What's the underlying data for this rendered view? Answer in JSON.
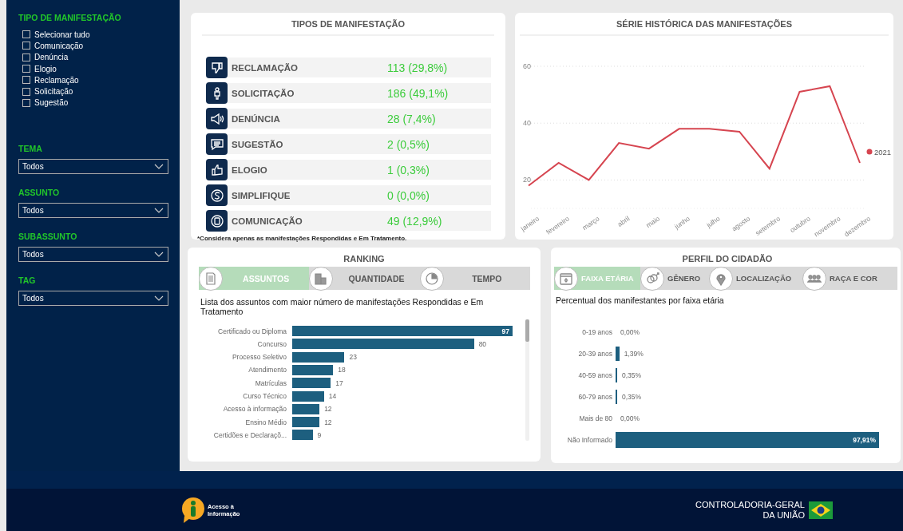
{
  "sidebar": {
    "filter_title": "TIPO DE MANIFESTAÇÃO",
    "options": [
      {
        "label": "Selecionar tudo",
        "checked": false
      },
      {
        "label": "Comunicação",
        "checked": false
      },
      {
        "label": "Denúncia",
        "checked": false
      },
      {
        "label": "Elogio",
        "checked": false
      },
      {
        "label": "Reclamação",
        "checked": false
      },
      {
        "label": "Solicitação",
        "checked": false
      },
      {
        "label": "Sugestão",
        "checked": false
      }
    ],
    "dropdowns": [
      {
        "label": "TEMA",
        "value": "Todos"
      },
      {
        "label": "ASSUNTO",
        "value": "Todos"
      },
      {
        "label": "SUBASSUNTO",
        "value": "Todos"
      },
      {
        "label": "TAG",
        "value": "Todos"
      }
    ]
  },
  "tipos": {
    "title": "TIPOS DE MANIFESTAÇÃO",
    "rows": [
      {
        "label": "RECLAMAÇÃO",
        "value": "113 (29,8%)"
      },
      {
        "label": "SOLICITAÇÃO",
        "value": "186 (49,1%)"
      },
      {
        "label": "DENÚNCIA",
        "value": "28 (7,4%)"
      },
      {
        "label": "SUGESTÃO",
        "value": "2 (0,5%)"
      },
      {
        "label": "ELOGIO",
        "value": "1 (0,3%)"
      },
      {
        "label": "SIMPLIFIQUE",
        "value": "0 (0,0%)"
      },
      {
        "label": "COMUNICAÇÃO",
        "value": "49 (12,9%)"
      }
    ],
    "footnote": "*Considera apenas as manifestações Respondidas e Em Tratamento."
  },
  "serie": {
    "title": "SÉRIE HISTÓRICA DAS MANIFESTAÇÕES",
    "chart_data": {
      "type": "line",
      "categories": [
        "janeiro",
        "fevereiro",
        "março",
        "abril",
        "maio",
        "junho",
        "julho",
        "agosto",
        "setembro",
        "outubro",
        "novembro",
        "dezembro"
      ],
      "series": [
        {
          "name": "2021",
          "color": "#d64550",
          "values": [
            18,
            26,
            20,
            33,
            31,
            38,
            38,
            37,
            24,
            51,
            53,
            26
          ]
        }
      ],
      "ylim": [
        10,
        60
      ],
      "yticks": [
        20,
        40,
        60
      ]
    }
  },
  "ranking": {
    "title": "RANKING",
    "tabs": [
      {
        "label": "ASSUNTOS",
        "selected": true
      },
      {
        "label": "QUANTIDADE",
        "selected": false
      },
      {
        "label": "TEMPO",
        "selected": false
      }
    ],
    "description": "Lista dos assuntos com maior número de manifestações Respondidas e Em Tratamento",
    "chart_data": {
      "type": "bar",
      "orientation": "horizontal",
      "data_labels": true,
      "categories": [
        "Certificado ou Diploma",
        "Concurso",
        "Processo Seletivo",
        "Atendimento",
        "Matrículas",
        "Curso Técnico",
        "Acesso à informação",
        "Ensino Médio",
        "Certidões e Declaraçõ..."
      ],
      "values": [
        97,
        80,
        23,
        18,
        17,
        14,
        12,
        12,
        9
      ]
    }
  },
  "perfil": {
    "title": "PERFIL DO CIDADÃO",
    "tabs": [
      {
        "label": "FAIXA ETÁRIA",
        "selected": true
      },
      {
        "label": "GÊNERO",
        "selected": false
      },
      {
        "label": "LOCALIZAÇÃO",
        "selected": false
      },
      {
        "label": "RAÇA E COR",
        "selected": false
      }
    ],
    "description": "Percentual dos manifestantes por faixa etária",
    "chart_data": {
      "type": "bar",
      "orientation": "horizontal",
      "categories": [
        "0-19 anos",
        "20-39 anos",
        "40-59 anos",
        "60-79 anos",
        "Mais de 80",
        "Não Informado"
      ],
      "values": [
        0,
        1.39,
        0.35,
        0.35,
        0,
        97.91
      ],
      "value_labels": [
        "0,00%",
        "1,39%",
        "0,35%",
        "0,35%",
        "0,00%",
        "97,91%"
      ]
    }
  },
  "footer": {
    "access_logo": [
      "Acesso à",
      "Informação"
    ],
    "agency": [
      "CONTROLADORIA-GERAL",
      "DA UNIÃO"
    ]
  }
}
